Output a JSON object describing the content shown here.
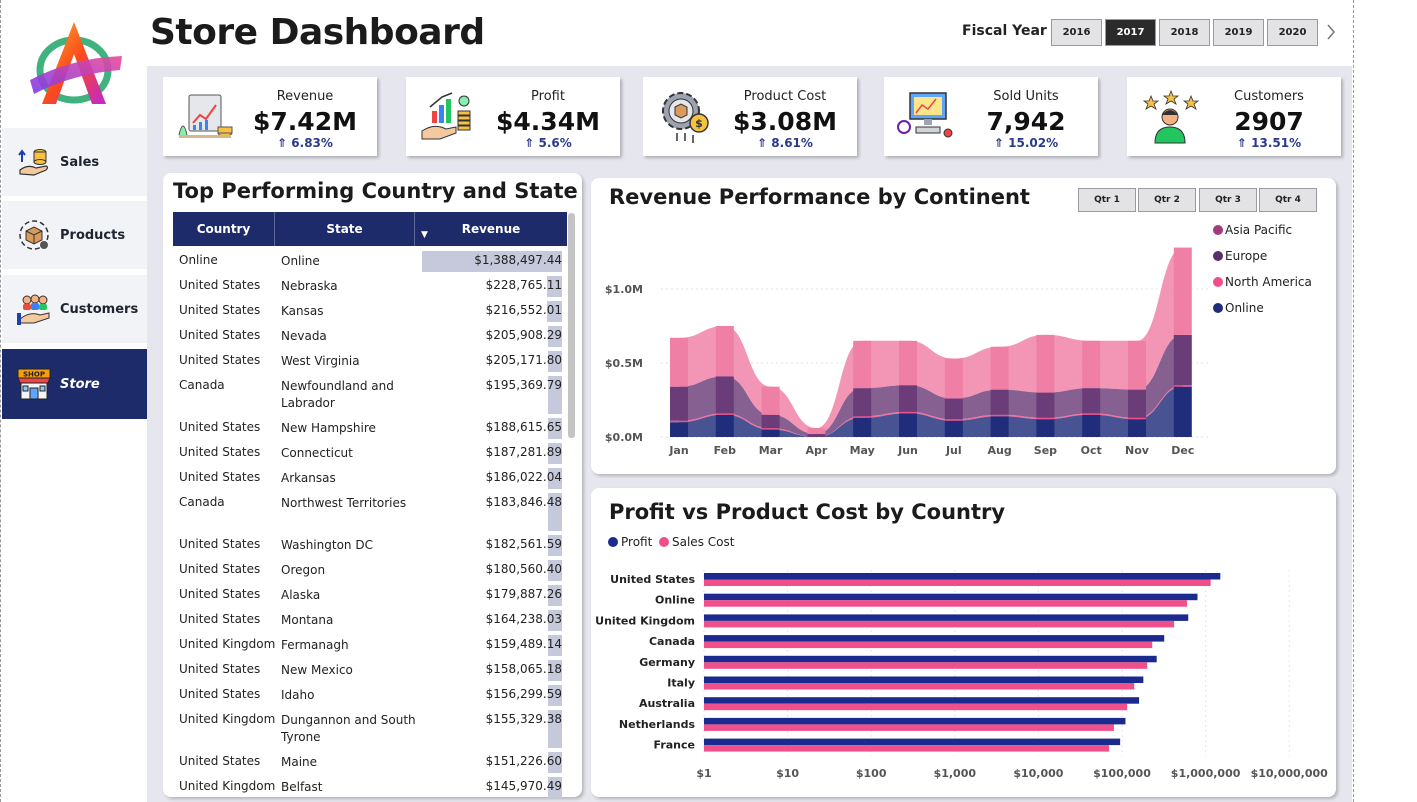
{
  "header": {
    "title": "Store Dashboard",
    "fiscal_year_label": "Fiscal Year",
    "years": [
      "2016",
      "2017",
      "2018",
      "2019",
      "2020"
    ],
    "selected_year": "2017"
  },
  "sidebar": {
    "items": [
      {
        "label": "Sales",
        "icon": "coins-hand-icon",
        "active": false
      },
      {
        "label": "Products",
        "icon": "product-box-icon",
        "active": false
      },
      {
        "label": "Customers",
        "icon": "customers-hand-icon",
        "active": false
      },
      {
        "label": "Store",
        "icon": "shop-icon",
        "active": true
      }
    ],
    "store_sign": "SHOP"
  },
  "kpis": [
    {
      "title": "Revenue",
      "value": "$7.42M",
      "delta": "⇑ 6.83%",
      "icon": "revenue-chart-icon"
    },
    {
      "title": "Profit",
      "value": "$4.34M",
      "delta": "⇑ 5.6%",
      "icon": "profit-growth-icon"
    },
    {
      "title": "Product Cost",
      "value": "$3.08M",
      "delta": "⇑ 8.61%",
      "icon": "gear-cost-icon"
    },
    {
      "title": "Sold Units",
      "value": "7,942",
      "delta": "⇑ 15.02%",
      "icon": "computer-units-icon"
    },
    {
      "title": "Customers",
      "value": "2907",
      "delta": "⇑ 13.51%",
      "icon": "customer-stars-icon"
    }
  ],
  "top_table": {
    "title": "Top Performing Country and State",
    "columns": [
      "Country",
      "State",
      "Revenue"
    ],
    "sort_indicator": "▼",
    "rows": [
      {
        "country": "Online",
        "state": "Online",
        "revenue": "$1,388,497.44",
        "value": 1388497.44
      },
      {
        "country": "United States",
        "state": "Nebraska",
        "revenue": "$228,765.11",
        "value": 228765.11
      },
      {
        "country": "United States",
        "state": "Kansas",
        "revenue": "$216,552.01",
        "value": 216552.01
      },
      {
        "country": "United States",
        "state": "Nevada",
        "revenue": "$205,908.29",
        "value": 205908.29
      },
      {
        "country": "United States",
        "state": "West Virginia",
        "revenue": "$205,171.80",
        "value": 205171.8
      },
      {
        "country": "Canada",
        "state": "Newfoundland and Labrador",
        "revenue": "$195,369.79",
        "value": 195369.79
      },
      {
        "country": "United States",
        "state": "New Hampshire",
        "revenue": "$188,615.65",
        "value": 188615.65
      },
      {
        "country": "United States",
        "state": "Connecticut",
        "revenue": "$187,281.89",
        "value": 187281.89
      },
      {
        "country": "United States",
        "state": "Arkansas",
        "revenue": "$186,022.04",
        "value": 186022.04
      },
      {
        "country": "Canada",
        "state": "Northwest Territories",
        "revenue": "$183,846.48",
        "value": 183846.48
      },
      {
        "country": "United States",
        "state": "Washington DC",
        "revenue": "$182,561.59",
        "value": 182561.59
      },
      {
        "country": "United States",
        "state": "Oregon",
        "revenue": "$180,560.40",
        "value": 180560.4
      },
      {
        "country": "United States",
        "state": "Alaska",
        "revenue": "$179,887.26",
        "value": 179887.26
      },
      {
        "country": "United States",
        "state": "Montana",
        "revenue": "$164,238.03",
        "value": 164238.03
      },
      {
        "country": "United Kingdom",
        "state": "Fermanagh",
        "revenue": "$159,489.14",
        "value": 159489.14
      },
      {
        "country": "United States",
        "state": "New Mexico",
        "revenue": "$158,065.18",
        "value": 158065.18
      },
      {
        "country": "United States",
        "state": "Idaho",
        "revenue": "$156,299.59",
        "value": 156299.59
      },
      {
        "country": "United Kingdom",
        "state": "Dungannon and South Tyrone",
        "revenue": "$155,329.38",
        "value": 155329.38
      },
      {
        "country": "United States",
        "state": "Maine",
        "revenue": "$151,226.60",
        "value": 151226.6
      },
      {
        "country": "United Kingdom",
        "state": "Belfast",
        "revenue": "$145,970.49",
        "value": 145970.49
      }
    ]
  },
  "chart_data": [
    {
      "type": "area",
      "title": "Revenue Performance by Continent",
      "quarter_buttons": [
        "Qtr 1",
        "Qtr 2",
        "Qtr 3",
        "Qtr 4"
      ],
      "categories": [
        "Jan",
        "Feb",
        "Mar",
        "Apr",
        "May",
        "Jun",
        "Jul",
        "Aug",
        "Sep",
        "Oct",
        "Nov",
        "Dec"
      ],
      "yticks": [
        {
          "v": 0,
          "label": "$0.0M"
        },
        {
          "v": 0.5,
          "label": "$0.5M"
        },
        {
          "v": 1.0,
          "label": "$1.0M"
        }
      ],
      "ylim": [
        0,
        1.3
      ],
      "stacked": true,
      "series": [
        {
          "name": "Online",
          "color": "#1f2d7a",
          "values": [
            0.1,
            0.15,
            0.05,
            0.0,
            0.13,
            0.16,
            0.11,
            0.14,
            0.12,
            0.15,
            0.12,
            0.34
          ]
        },
        {
          "name": "North America",
          "color": "#ef4f8a",
          "values": [
            0.01,
            0.01,
            0.01,
            0.0,
            0.01,
            0.01,
            0.01,
            0.01,
            0.01,
            0.01,
            0.01,
            0.01
          ]
        },
        {
          "name": "Europe",
          "color": "#6a3d78",
          "values": [
            0.23,
            0.25,
            0.09,
            0.02,
            0.19,
            0.18,
            0.14,
            0.17,
            0.17,
            0.17,
            0.19,
            0.34
          ]
        },
        {
          "name": "Asia Pacific",
          "color": "#f07fa6",
          "values": [
            0.33,
            0.34,
            0.19,
            0.04,
            0.32,
            0.3,
            0.27,
            0.29,
            0.39,
            0.32,
            0.33,
            0.59
          ]
        }
      ],
      "legend": [
        "Asia Pacific",
        "Europe",
        "North America",
        "Online"
      ],
      "legend_colors": [
        "#a23a7c",
        "#5a2f6a",
        "#ef4f8a",
        "#1f2d7a"
      ],
      "legend_position": "right"
    },
    {
      "type": "bar",
      "orientation": "horizontal",
      "title": "Profit vs Product Cost by Country",
      "x_scale": "log",
      "categories": [
        "United States",
        "Online",
        "United Kingdom",
        "Canada",
        "Germany",
        "Italy",
        "Australia",
        "Netherlands",
        "France"
      ],
      "series": [
        {
          "name": "Profit",
          "color": "#1b2a8f",
          "values": [
            1500000,
            800000,
            620000,
            320000,
            260000,
            180000,
            160000,
            110000,
            95000
          ]
        },
        {
          "name": "Sales Cost",
          "color": "#ef4f8a",
          "values": [
            1150000,
            600000,
            420000,
            230000,
            200000,
            140000,
            115000,
            80000,
            70000
          ]
        }
      ],
      "xticks": [
        {
          "v": 1,
          "label": "$1"
        },
        {
          "v": 10,
          "label": "$10"
        },
        {
          "v": 100,
          "label": "$100"
        },
        {
          "v": 1000,
          "label": "$1,000"
        },
        {
          "v": 10000,
          "label": "$10,000"
        },
        {
          "v": 100000,
          "label": "$100,000"
        },
        {
          "v": 1000000,
          "label": "$1,000,000"
        },
        {
          "v": 10000000,
          "label": "$10,000,000"
        }
      ],
      "legend_position": "top-left"
    }
  ]
}
